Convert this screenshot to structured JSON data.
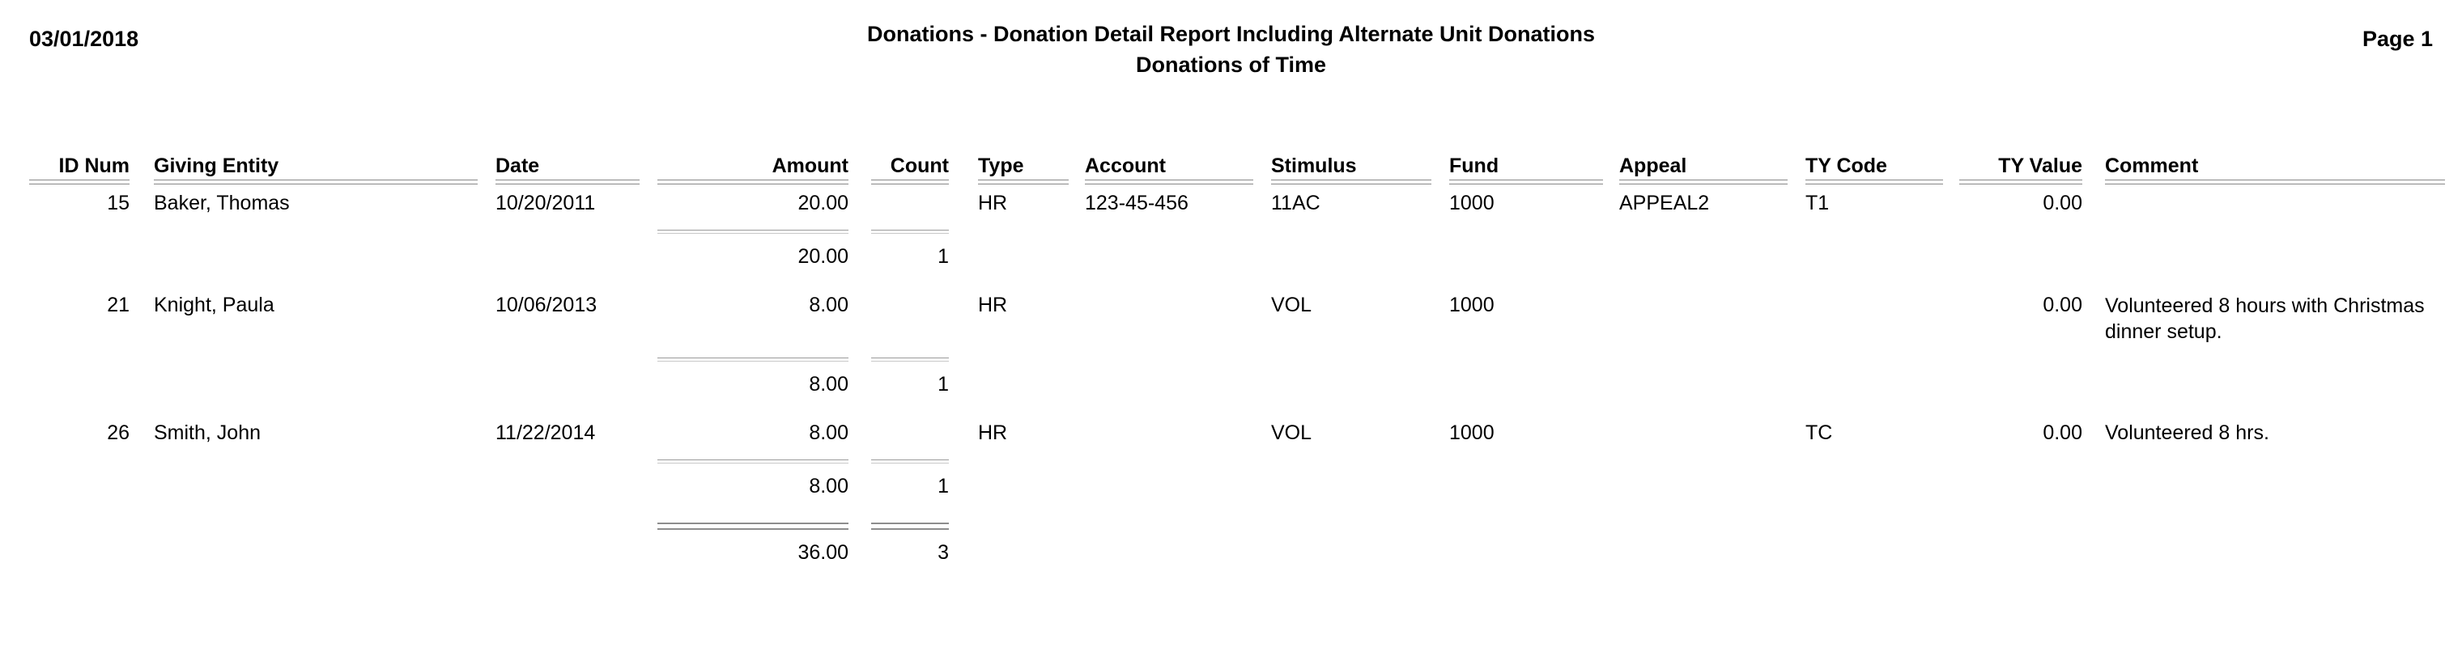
{
  "header": {
    "date": "03/01/2018",
    "title": "Donations - Donation Detail Report Including Alternate Unit Donations",
    "subtitle": "Donations of Time",
    "page_label": "Page 1"
  },
  "table": {
    "columns": [
      {
        "key": "id_num",
        "label": "ID Num",
        "align": "right"
      },
      {
        "key": "giving_entity",
        "label": "Giving Entity",
        "align": "left"
      },
      {
        "key": "date",
        "label": "Date",
        "align": "left"
      },
      {
        "key": "amount",
        "label": "Amount",
        "align": "right"
      },
      {
        "key": "count",
        "label": "Count",
        "align": "right"
      },
      {
        "key": "type",
        "label": "Type",
        "align": "left"
      },
      {
        "key": "account",
        "label": "Account",
        "align": "left"
      },
      {
        "key": "stimulus",
        "label": "Stimulus",
        "align": "left"
      },
      {
        "key": "fund",
        "label": "Fund",
        "align": "left"
      },
      {
        "key": "appeal",
        "label": "Appeal",
        "align": "left"
      },
      {
        "key": "ty_code",
        "label": "TY Code",
        "align": "left"
      },
      {
        "key": "ty_value",
        "label": "TY Value",
        "align": "right"
      },
      {
        "key": "comment",
        "label": "Comment",
        "align": "left"
      }
    ],
    "rows": [
      {
        "id_num": "15",
        "giving_entity": "Baker, Thomas",
        "date": "10/20/2011",
        "amount": "20.00",
        "count": "",
        "type": "HR",
        "account": "123-45-456",
        "stimulus": "11AC",
        "fund": "1000",
        "appeal": "APPEAL2",
        "ty_code": "T1",
        "ty_value": "0.00",
        "comment": ""
      },
      {
        "id_num": "21",
        "giving_entity": "Knight, Paula",
        "date": "10/06/2013",
        "amount": "8.00",
        "count": "",
        "type": "HR",
        "account": "",
        "stimulus": "VOL",
        "fund": "1000",
        "appeal": "",
        "ty_code": "",
        "ty_value": "0.00",
        "comment": "Volunteered 8 hours with Christmas dinner setup."
      },
      {
        "id_num": "26",
        "giving_entity": "Smith, John",
        "date": "11/22/2014",
        "amount": "8.00",
        "count": "",
        "type": "HR",
        "account": "",
        "stimulus": "VOL",
        "fund": "1000",
        "appeal": "",
        "ty_code": "TC",
        "ty_value": "0.00",
        "comment": "Volunteered 8 hrs."
      }
    ],
    "subtotals": [
      {
        "amount": "20.00",
        "count": "1"
      },
      {
        "amount": "8.00",
        "count": "1"
      },
      {
        "amount": "8.00",
        "count": "1"
      }
    ],
    "grand_total": {
      "amount": "36.00",
      "count": "3"
    }
  }
}
